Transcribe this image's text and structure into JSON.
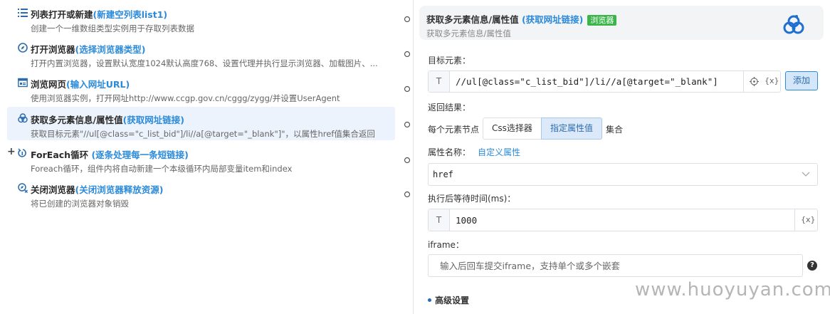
{
  "steps": [
    {
      "title": "列表打开或新建",
      "param": "(新建空列表list1)",
      "desc": "创建一个一维数组类型实例用于存取列表数据",
      "icon": "list-icon"
    },
    {
      "title": "打开浏览器",
      "param": "(选择浏览器类型)",
      "desc": "打开内置浏览器，设置默认宽度1024默认高度768、设置代理并执行显示浏览器、加载图片、...",
      "icon": "compass-icon"
    },
    {
      "title": "浏览网页",
      "param": "(输入网址URL)",
      "desc": "使用浏览器实例，打开网址http://www.ccgp.gov.cn/cggg/zygg/并设置UserAgent",
      "icon": "browser-window-icon"
    },
    {
      "title": "获取多元素信息/属性值",
      "param": "(获取网址链接)",
      "desc": "获取目标元素\"//ul[@class=\"c_list_bid\"]/li//a[@target=\"_blank\"]\"，以属性href值集合返回",
      "icon": "multi-element-icon"
    },
    {
      "title": "ForEach循环",
      "param": "(逐条处理每一条短链接)",
      "desc": "Foreach循环，组件内将自动新建一个本级循环内局部变量item和index",
      "icon": "loop-icon"
    },
    {
      "title": "关闭浏览器",
      "param": "(关闭浏览器释放资源)",
      "desc": "将已创建的浏览器对象销毁",
      "icon": "close-browser-icon"
    }
  ],
  "expand_symbol": "+",
  "panel": {
    "title": "获取多元素信息/属性值",
    "param": "(获取网址链接)",
    "badge": "浏览器",
    "subtitle": "获取多元素信息/属性值",
    "target_label": "目标元素：",
    "target_prefix": "T",
    "target_value": "//ul[@class=\"c_list_bid\"]/li//a[@target=\"_blank\"]",
    "var_label": "{x}",
    "add_label": "添加",
    "result_label": "返回结果：",
    "each_node_label": "每个元素节点",
    "seg_css": "Css选择器",
    "seg_attr": "指定属性值",
    "collection_label": "集合",
    "attr_name_label": "属性名称：",
    "custom_attr_label": "自定义属性",
    "attr_value": "href",
    "wait_label": "执行后等待时间(ms)：",
    "wait_prefix": "T",
    "wait_value": "1000",
    "wait_var_label": "{x}",
    "iframe_label": "iframe：",
    "iframe_placeholder": "输入后回车提交iframe，支持单个或多个嵌套",
    "help_symbol": "?",
    "advanced_label": "高级设置"
  },
  "watermark": "www.huoyuyan.com",
  "colors": {
    "accent": "#2b8ad9",
    "badge": "#3bb54a",
    "active_row": "#edf3fc"
  }
}
